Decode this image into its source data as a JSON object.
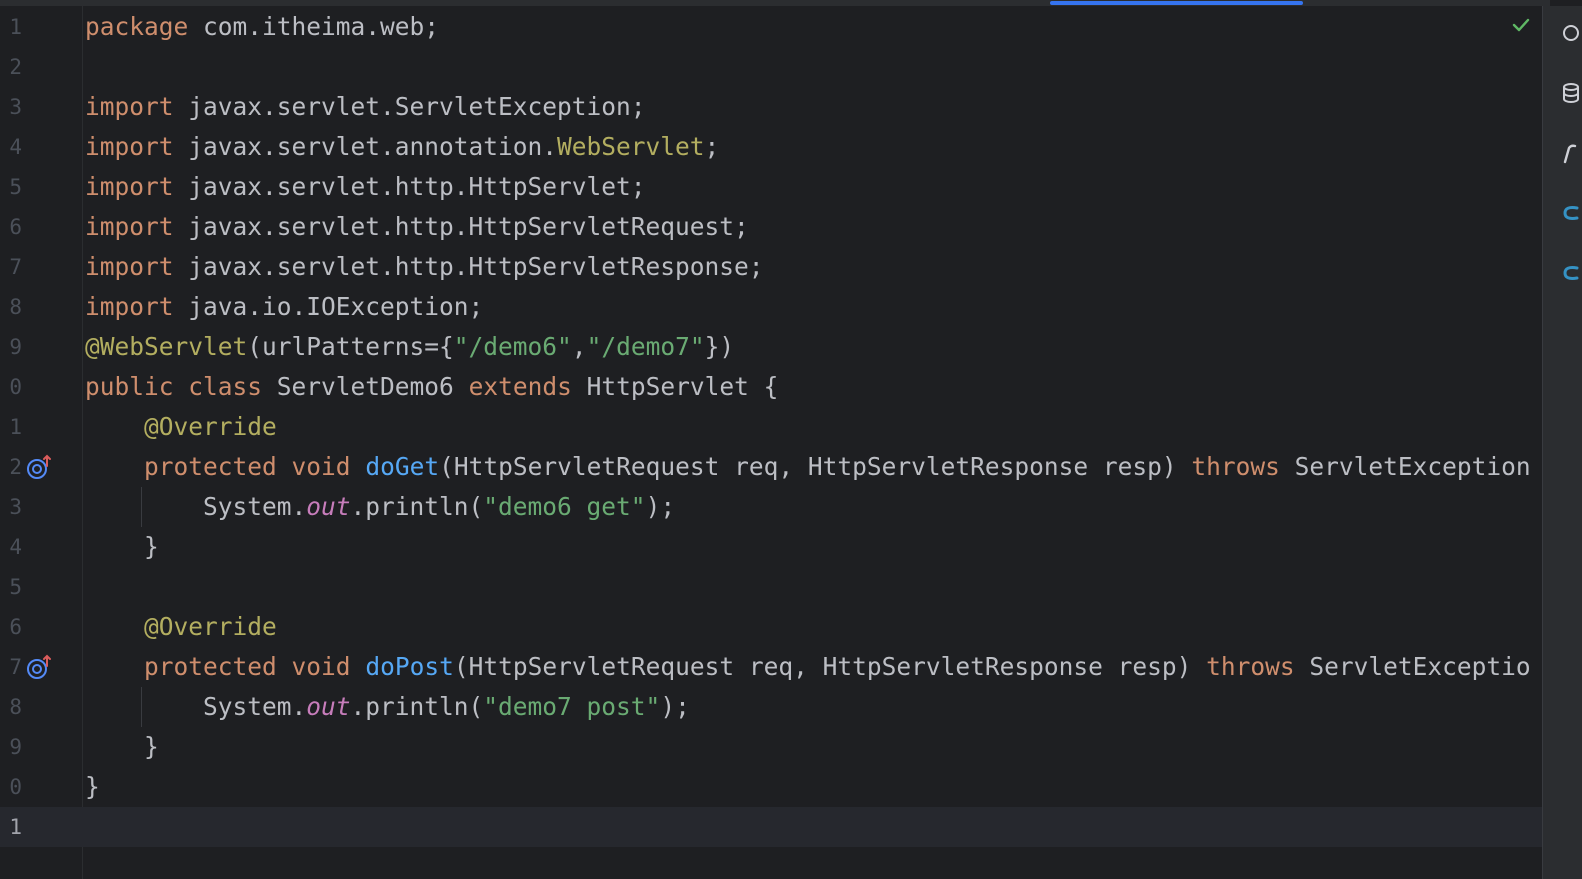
{
  "editor": {
    "lines": [
      {
        "num": "1",
        "tokens": [
          {
            "t": "package",
            "c": "kw"
          },
          {
            "t": " com.itheima.web;",
            "c": "plain"
          }
        ]
      },
      {
        "num": "2",
        "tokens": []
      },
      {
        "num": "3",
        "tokens": [
          {
            "t": "import",
            "c": "kw"
          },
          {
            "t": " javax.servlet.ServletException;",
            "c": "plain"
          }
        ]
      },
      {
        "num": "4",
        "tokens": [
          {
            "t": "import",
            "c": "kw"
          },
          {
            "t": " javax.servlet.annotation.",
            "c": "plain"
          },
          {
            "t": "WebServlet",
            "c": "ann"
          },
          {
            "t": ";",
            "c": "plain"
          }
        ]
      },
      {
        "num": "5",
        "tokens": [
          {
            "t": "import",
            "c": "kw"
          },
          {
            "t": " javax.servlet.http.HttpServlet;",
            "c": "plain"
          }
        ]
      },
      {
        "num": "6",
        "tokens": [
          {
            "t": "import",
            "c": "kw"
          },
          {
            "t": " javax.servlet.http.HttpServletRequest;",
            "c": "plain"
          }
        ]
      },
      {
        "num": "7",
        "tokens": [
          {
            "t": "import",
            "c": "kw"
          },
          {
            "t": " javax.servlet.http.HttpServletResponse;",
            "c": "plain"
          }
        ]
      },
      {
        "num": "8",
        "tokens": [
          {
            "t": "import",
            "c": "kw"
          },
          {
            "t": " java.io.IOException;",
            "c": "plain"
          }
        ]
      },
      {
        "num": "9",
        "tokens": [
          {
            "t": "@WebServlet",
            "c": "ann"
          },
          {
            "t": "(urlPatterns={",
            "c": "plain"
          },
          {
            "t": "\"/demo6\"",
            "c": "str"
          },
          {
            "t": ",",
            "c": "plain"
          },
          {
            "t": "\"/demo7\"",
            "c": "str"
          },
          {
            "t": "})",
            "c": "plain"
          }
        ]
      },
      {
        "num": "0",
        "tokens": [
          {
            "t": "public",
            "c": "kw"
          },
          {
            "t": " ",
            "c": "plain"
          },
          {
            "t": "class",
            "c": "kw"
          },
          {
            "t": " ServletDemo6 ",
            "c": "plain"
          },
          {
            "t": "extends",
            "c": "kw"
          },
          {
            "t": " HttpServlet {",
            "c": "plain"
          }
        ]
      },
      {
        "num": "1",
        "tokens": [
          {
            "t": "    ",
            "c": "plain"
          },
          {
            "t": "@Override",
            "c": "ann"
          }
        ]
      },
      {
        "num": "2",
        "tokens": [
          {
            "t": "    ",
            "c": "plain"
          },
          {
            "t": "protected",
            "c": "kw"
          },
          {
            "t": " ",
            "c": "plain"
          },
          {
            "t": "void",
            "c": "kw"
          },
          {
            "t": " ",
            "c": "plain"
          },
          {
            "t": "doGet",
            "c": "fn"
          },
          {
            "t": "(HttpServletRequest req, HttpServletResponse resp) ",
            "c": "plain"
          },
          {
            "t": "throws",
            "c": "kw"
          },
          {
            "t": " ServletException",
            "c": "plain"
          }
        ]
      },
      {
        "num": "3",
        "tokens": [
          {
            "t": "        System.",
            "c": "plain"
          },
          {
            "t": "out",
            "c": "static"
          },
          {
            "t": ".println(",
            "c": "plain"
          },
          {
            "t": "\"demo6 get\"",
            "c": "str"
          },
          {
            "t": ");",
            "c": "plain"
          }
        ]
      },
      {
        "num": "4",
        "tokens": [
          {
            "t": "    }",
            "c": "plain"
          }
        ]
      },
      {
        "num": "5",
        "tokens": []
      },
      {
        "num": "6",
        "tokens": [
          {
            "t": "    ",
            "c": "plain"
          },
          {
            "t": "@Override",
            "c": "ann"
          }
        ]
      },
      {
        "num": "7",
        "tokens": [
          {
            "t": "    ",
            "c": "plain"
          },
          {
            "t": "protected",
            "c": "kw"
          },
          {
            "t": " ",
            "c": "plain"
          },
          {
            "t": "void",
            "c": "kw"
          },
          {
            "t": " ",
            "c": "plain"
          },
          {
            "t": "doPost",
            "c": "fn"
          },
          {
            "t": "(HttpServletRequest req, HttpServletResponse resp) ",
            "c": "plain"
          },
          {
            "t": "throws",
            "c": "kw"
          },
          {
            "t": " ServletExceptio",
            "c": "plain"
          }
        ]
      },
      {
        "num": "8",
        "tokens": [
          {
            "t": "        System.",
            "c": "plain"
          },
          {
            "t": "out",
            "c": "static"
          },
          {
            "t": ".println(",
            "c": "plain"
          },
          {
            "t": "\"demo7 post\"",
            "c": "str"
          },
          {
            "t": ");",
            "c": "plain"
          }
        ]
      },
      {
        "num": "9",
        "tokens": [
          {
            "t": "    }",
            "c": "plain"
          }
        ]
      },
      {
        "num": "0",
        "tokens": [
          {
            "t": "}",
            "c": "plain"
          }
        ]
      },
      {
        "num": "1",
        "tokens": []
      }
    ],
    "current_line_index": 20,
    "override_icon_lines": [
      11,
      16
    ],
    "inspection_status": "check-icon"
  },
  "colors": {
    "background": "#1e1f22",
    "keyword": "#cf8e6d",
    "string": "#6aab73",
    "annotation": "#b3ae60",
    "function": "#56a8f5",
    "static_field": "#c77dbb",
    "plain": "#bcbec4",
    "accent": "#3574f0"
  },
  "right_panel": {
    "icons": [
      "notifications-icon",
      "database-icon",
      "maven-icon",
      "copilot-icon",
      "assistant-icon"
    ]
  }
}
